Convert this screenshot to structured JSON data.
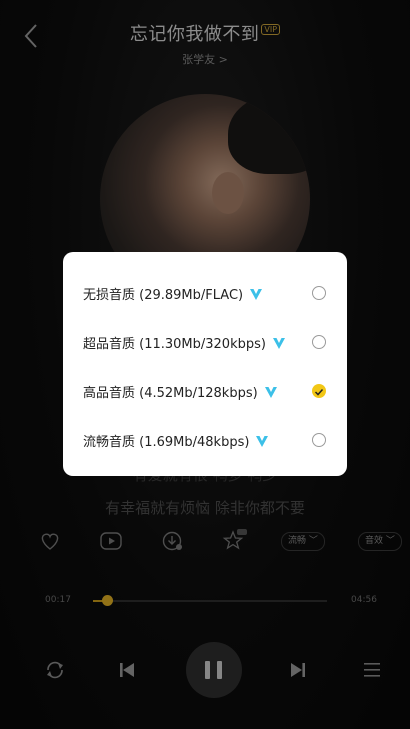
{
  "header": {
    "title": "忘记你我做不到",
    "vip_label": "VIP",
    "artist": "张学友 >"
  },
  "lyrics": {
    "line_a": "有爱就有恨 鸭多 鸭少",
    "line_b": "有幸福就有烦恼 除非你都不要"
  },
  "actions": {
    "labels": [
      "流畅",
      "音效"
    ]
  },
  "player": {
    "current_time": "00:17",
    "total_time": "04:56",
    "progress": 0.06
  },
  "quality_dialog": {
    "options": [
      {
        "label": "无损音质  (29.89Mb/FLAC)",
        "selected": false
      },
      {
        "label": "超品音质  (11.30Mb/320kbps)",
        "selected": false
      },
      {
        "label": "高品音质  (4.52Mb/128kbps)",
        "selected": true
      },
      {
        "label": "流畅音质  (1.69Mb/48kbps)",
        "selected": false
      }
    ]
  },
  "colors": {
    "accent": "#f2c716",
    "vip_mark": "#3cc0e8",
    "progress": "#c99b1a"
  }
}
